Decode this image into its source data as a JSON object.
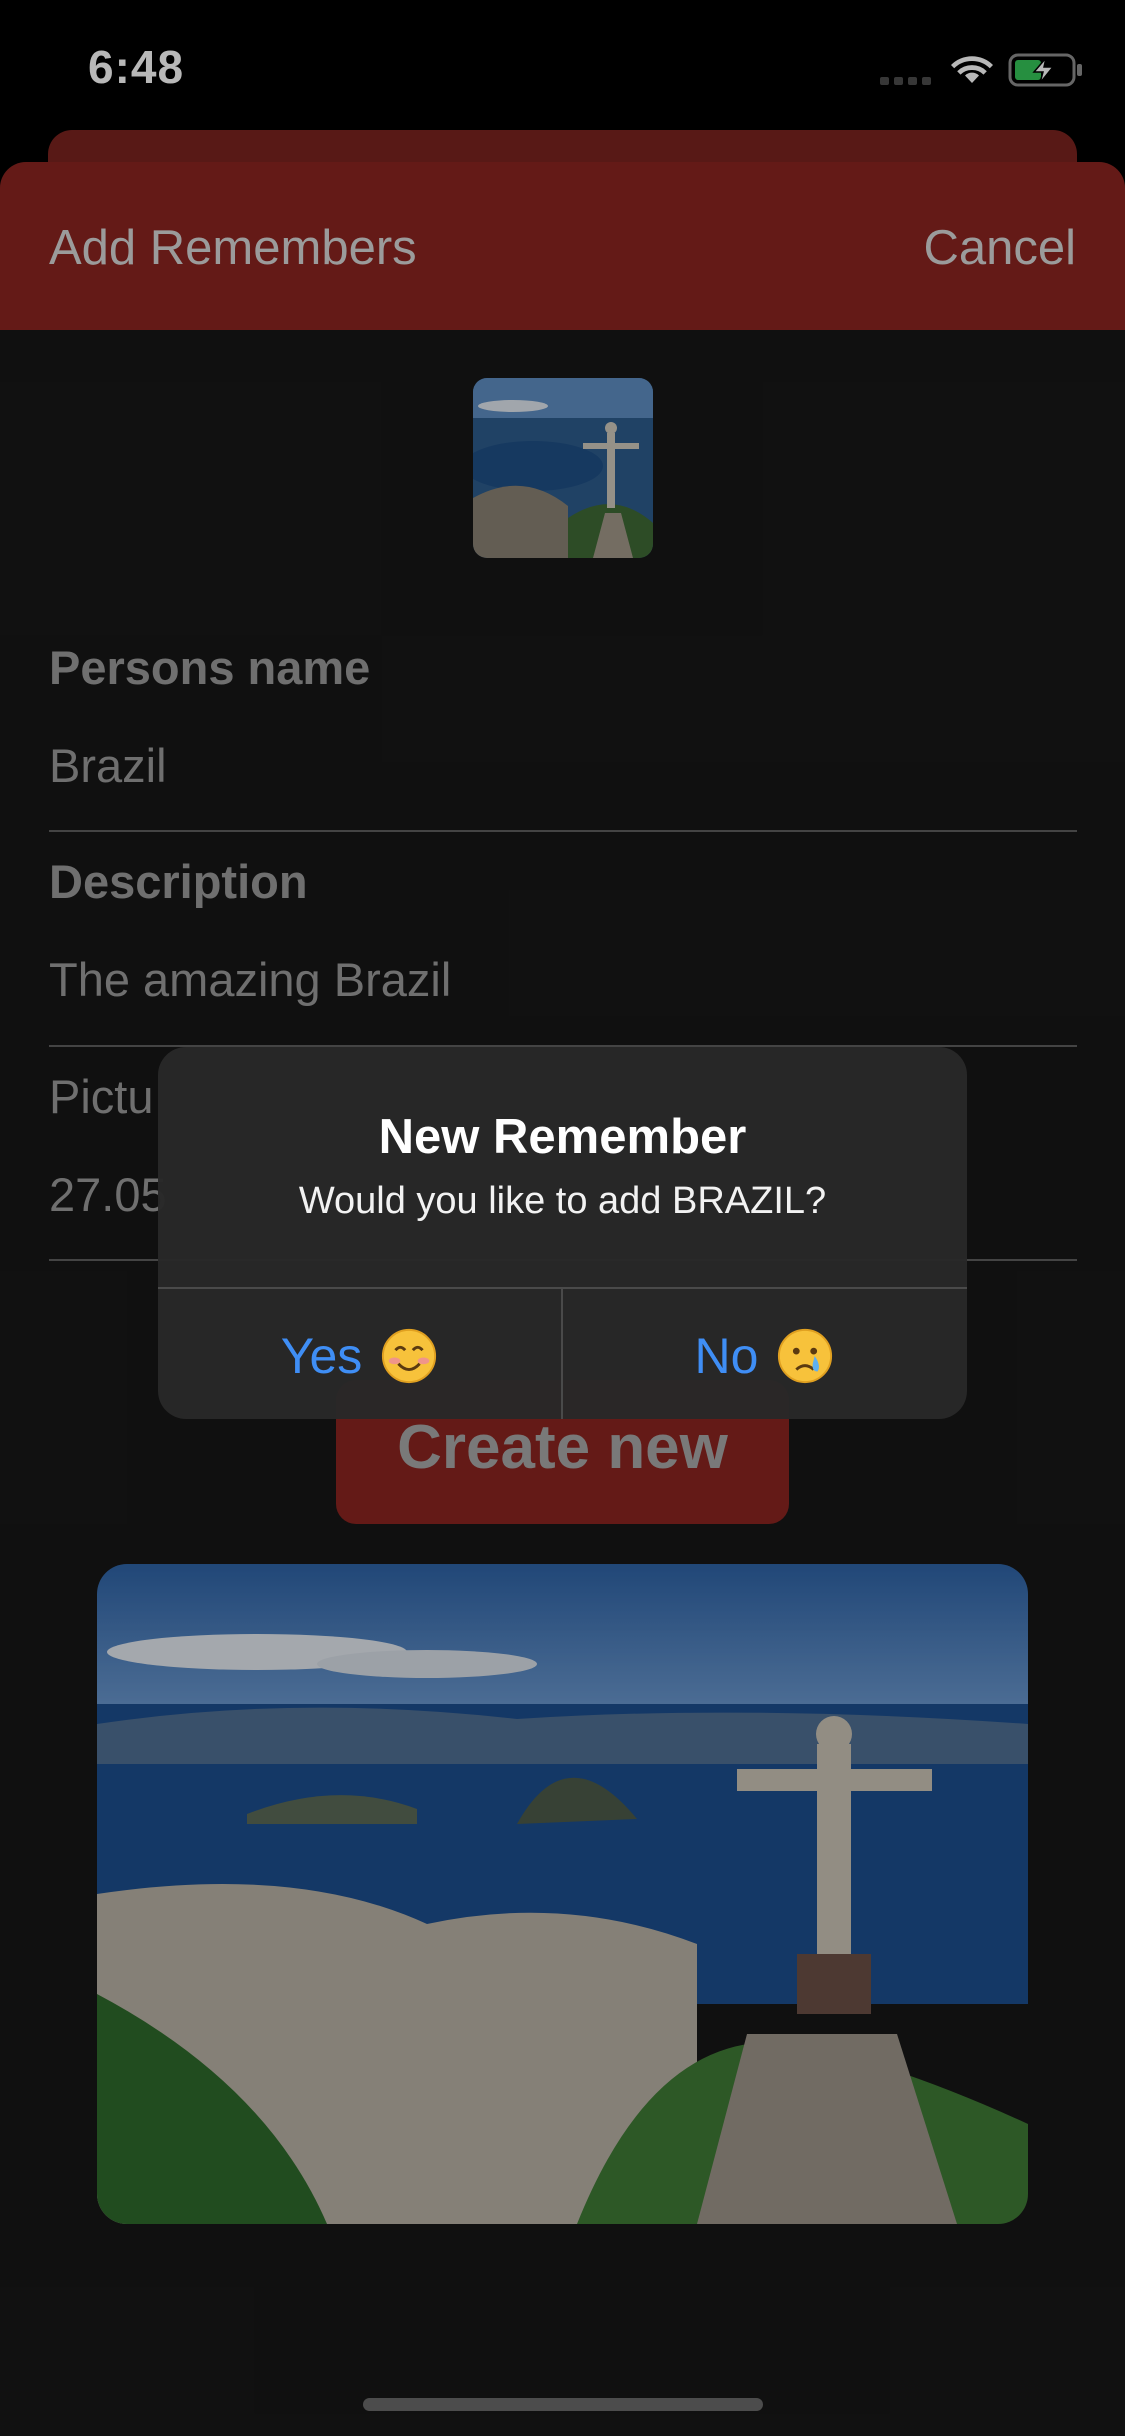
{
  "status_bar": {
    "time": "6:48",
    "icons": [
      "cellular-signal-icon",
      "wifi-icon",
      "battery-charging-icon"
    ]
  },
  "nav": {
    "title": "Add Remembers",
    "cancel_label": "Cancel"
  },
  "form": {
    "name_label": "Persons name",
    "name_value": "Brazil",
    "description_label": "Description",
    "description_value": "The amazing Brazil",
    "picture_label_visible": "Pictu",
    "picture_value_visible": "27.05"
  },
  "create_button_label": "Create new",
  "alert": {
    "title": "New Remember",
    "message": "Would you like to add BRAZIL?",
    "yes_label": "Yes",
    "no_label": "No",
    "yes_emoji": "smiling-face-icon",
    "no_emoji": "crying-face-icon"
  },
  "colors": {
    "accent_red": "#8b2520",
    "alert_button_blue": "#3f8ef5",
    "background": "#171717"
  }
}
